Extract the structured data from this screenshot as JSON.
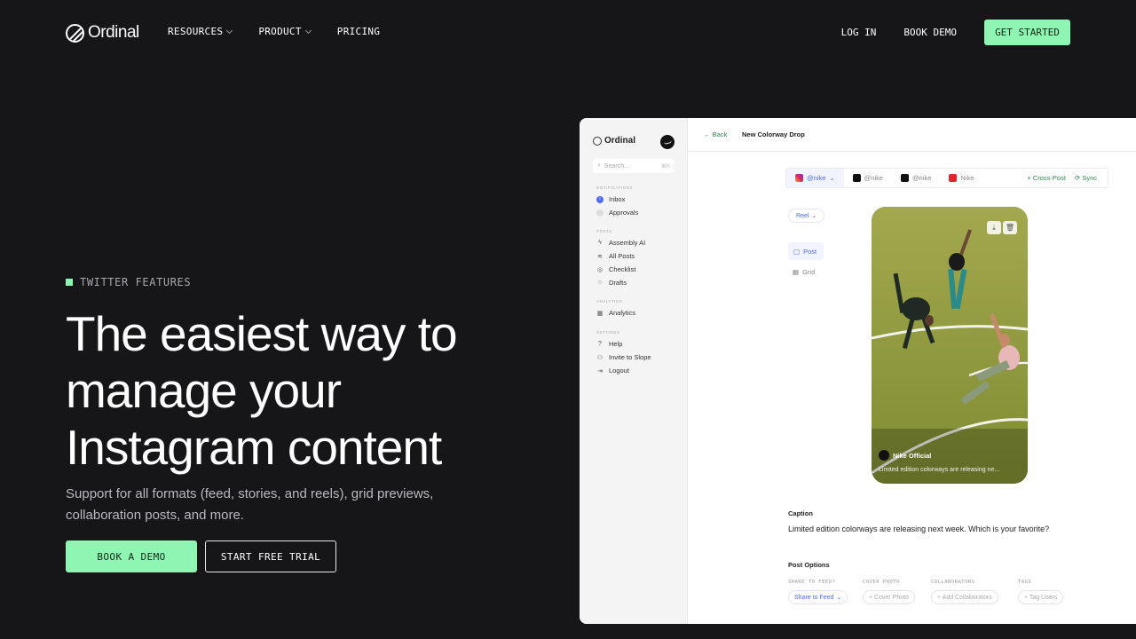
{
  "nav": {
    "logo": "Ordinal",
    "links": [
      {
        "label": "RESOURCES"
      },
      {
        "label": "PRODUCT"
      },
      {
        "label": "PRICING"
      }
    ],
    "login": "LOG IN",
    "book_demo": "BOOK DEMO",
    "get_started": "GET STARTED"
  },
  "hero": {
    "eyebrow": "TWITTER FEATURES",
    "headline": "The easiest way to manage your Instagram content",
    "subhead": "Support for all formats (feed, stories, and reels), grid previews, collaboration posts, and more.",
    "cta_primary": "BOOK A DEMO",
    "cta_secondary": "START FREE TRIAL"
  },
  "app": {
    "logo": "Ordinal",
    "search_placeholder": "Search...",
    "search_shortcut": "⌘K",
    "sections": {
      "notifications": "NOTIFICATIONS",
      "posts": "POSTS",
      "analytics": "ANALYTICS",
      "settings": "SETTINGS"
    },
    "items": {
      "inbox": "Inbox",
      "approvals": "Approvals",
      "assembly": "Assembly AI",
      "all_posts": "All Posts",
      "checklist": "Checklist",
      "drafts": "Drafts",
      "analytics": "Analytics",
      "help": "Help",
      "invite": "Invite to Slope",
      "logout": "Logout"
    },
    "back": "← Back",
    "title": "New Colorway Drop",
    "accounts": [
      "@nike",
      "@nike",
      "@nike",
      "Nike"
    ],
    "cross_post": "+ Cross-Post",
    "sync": "Sync",
    "format": "Reel",
    "view_post": "Post",
    "view_grid": "Grid",
    "phone_user": "Nike Official",
    "phone_caption": "Limited edition colorways are releasing ne...",
    "caption_label": "Caption",
    "caption_text": "Limited edition colorways are releasing next week. Which is your favorite?",
    "post_options_label": "Post Options",
    "options": {
      "share_label": "SHARE TO FEED?",
      "share_value": "Share to Feed",
      "cover_label": "COVER PHOTO",
      "cover_value": "+ Cover Photo",
      "collab_label": "COLLABORATORS",
      "collab_value": "+ Add Collaborators",
      "tags_label": "TAGS",
      "tags_value": "+ Tag Users"
    }
  },
  "colors": {
    "background": "#161517",
    "accent": "#8ef5b2",
    "link_blue": "#4f6bf0",
    "link_green": "#2f8a53"
  }
}
